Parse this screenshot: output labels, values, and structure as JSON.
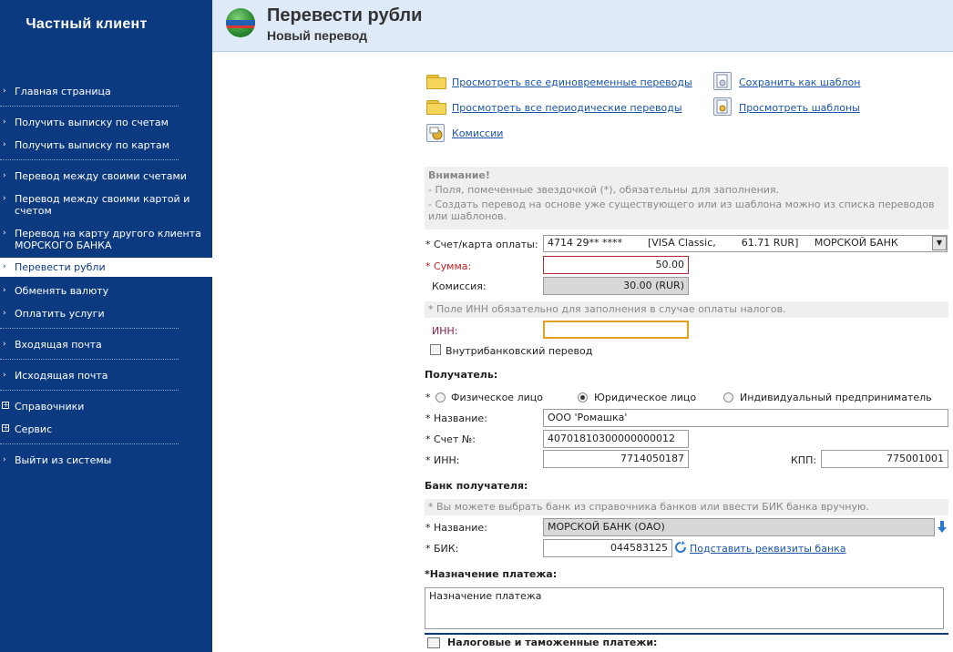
{
  "sidebar": {
    "brand": "Частный клиент",
    "items": [
      {
        "label": "Главная страница"
      },
      {
        "label": "Получить выписку по счетам"
      },
      {
        "label": "Получить выписку по картам"
      },
      {
        "label": "Перевод между своими счетами"
      },
      {
        "label": "Перевод между своими картой и счетом"
      },
      {
        "label": "Перевод на карту другого клиента МОРСКОГО БАНКА"
      },
      {
        "label": "Перевести рубли"
      },
      {
        "label": "Обменять валюту"
      },
      {
        "label": "Оплатить услуги"
      },
      {
        "label": "Входящая почта"
      },
      {
        "label": "Исходящая почта"
      },
      {
        "label": "Справочники"
      },
      {
        "label": "Сервис"
      },
      {
        "label": "Выйти из системы"
      }
    ]
  },
  "header": {
    "title": "Перевести рубли",
    "subtitle": "Новый перевод"
  },
  "links": {
    "one_time": "Просмотреть все единовременные переводы",
    "periodic": "Просмотреть все периодические переводы",
    "fees": "Комиссии",
    "save_template": "Сохранить как шаблон",
    "view_templates": "Просмотреть шаблоны"
  },
  "notice": {
    "title": "Внимание!",
    "line1": "- Поля, помеченные звездочкой (*), обязательны для заполнения.",
    "line2": "- Создать перевод на основе уже существующего или из шаблона можно из списка переводов или шаблонов."
  },
  "form": {
    "account_label": "* Счет/карта оплаты:",
    "account_value": "4714 29** ****        [VISA Classic,        61.71 RUR]     МОРСКОЙ БАНК",
    "amount_label": "* Сумма:",
    "amount_value": "50.00",
    "fee_label": "Комиссия:",
    "fee_value": "30.00 (RUR)",
    "inn_notice": "* Поле ИНН обязательно для заполнения в случае оплаты налогов.",
    "inn_label": "ИНН:",
    "inn_value": "",
    "intrabank_label": "Внутрибанковский перевод"
  },
  "recipient": {
    "section_title": "Получатель:",
    "type_star": "*",
    "types": [
      "Физическое лицо",
      "Юридическое лицо",
      "Индивидуальный предприниматель"
    ],
    "selected_type": "Юридическое лицо",
    "name_label": "* Название:",
    "name_value": "ООО 'Ромашка'",
    "account_label": "* Счет №:",
    "account_value": "40701810300000000012",
    "inn_label": "* ИНН:",
    "inn_value": "7714050187",
    "kpp_label": "КПП:",
    "kpp_value": "775001001"
  },
  "bank": {
    "section_title": "Банк получателя:",
    "notice": "* Вы можете выбрать банк из справочника банков или ввести БИК банка вручную.",
    "name_label": "* Название:",
    "name_value": "МОРСКОЙ БАНК (ОАО)",
    "bik_label": "* БИК:",
    "bik_value": "044583125",
    "fill_link": "Подставить реквизиты банка"
  },
  "purpose": {
    "section_title": "*Назначение платежа:",
    "value": "Назначение платежа"
  },
  "tax": {
    "section_title": "Налоговые и таможенные платежи:"
  }
}
